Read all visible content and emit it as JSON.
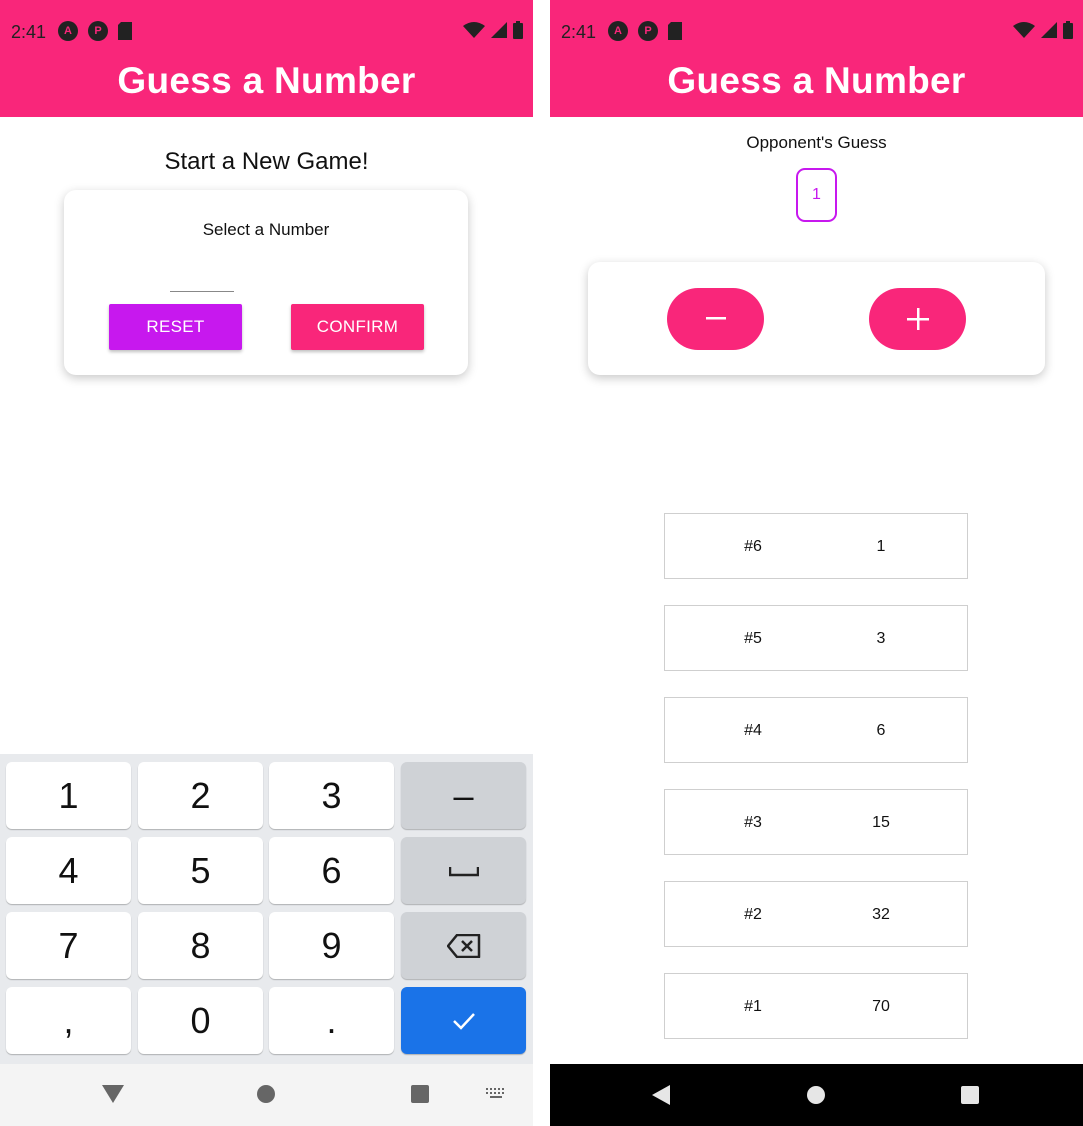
{
  "status": {
    "time": "2:41"
  },
  "app": {
    "title": "Guess a Number"
  },
  "start_screen": {
    "heading": "Start a New Game!",
    "select_label": "Select a Number",
    "input_value": "",
    "reset_label": "RESET",
    "confirm_label": "CONFIRM"
  },
  "keyboard": {
    "keys": [
      "1",
      "2",
      "3",
      "–",
      "4",
      "5",
      "6",
      "␣",
      "7",
      "8",
      "9",
      "⌫",
      ",",
      "0",
      ".",
      "✓"
    ]
  },
  "game_screen": {
    "opponent_label": "Opponent's Guess",
    "current_guess": "1",
    "rounds": [
      {
        "round": "#6",
        "guess": "1"
      },
      {
        "round": "#5",
        "guess": "3"
      },
      {
        "round": "#4",
        "guess": "6"
      },
      {
        "round": "#3",
        "guess": "15"
      },
      {
        "round": "#2",
        "guess": "32"
      },
      {
        "round": "#1",
        "guess": "70"
      }
    ]
  },
  "colors": {
    "primary": "#f9267a",
    "accent": "#c718ee",
    "enter": "#1a73e8"
  }
}
